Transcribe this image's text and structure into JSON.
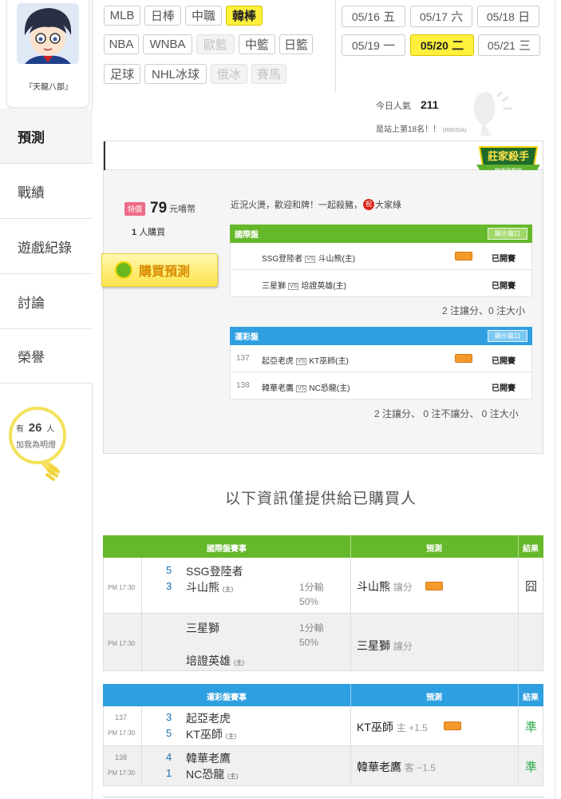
{
  "user": {
    "name": "『天龍八部』"
  },
  "sidebar": {
    "tabs": [
      {
        "label": "預測"
      },
      {
        "label": "戰績"
      },
      {
        "label": "遊戲紀錄"
      },
      {
        "label": "討論"
      },
      {
        "label": "榮譽"
      }
    ],
    "fans": {
      "prefix": "有",
      "count": "26",
      "suffix": "人",
      "text": "加我為明燈"
    }
  },
  "leagues": {
    "row1": [
      "MLB",
      "日棒",
      "中職",
      "韓棒"
    ],
    "row2": [
      "NBA",
      "WNBA",
      "歐籃",
      "中籃",
      "日籃"
    ],
    "row3": [
      "足球",
      "NHL冰球",
      "俄冰",
      "賽馬"
    ]
  },
  "dates": [
    {
      "date": "05/16",
      "day": "五"
    },
    {
      "date": "05/17",
      "day": "六"
    },
    {
      "date": "05/18",
      "day": "日"
    },
    {
      "date": "05/19",
      "day": "一"
    },
    {
      "date": "05/20",
      "day": "二"
    },
    {
      "date": "05/21",
      "day": "三"
    }
  ],
  "popularity": {
    "label": "今日人氣",
    "value": "211",
    "rank_text": "是站上第18名！！",
    "rank_code": "(R8033A)"
  },
  "badge": {
    "title": "莊家殺手",
    "sub": "韓棒國際盤"
  },
  "purchase": {
    "tag": "特價",
    "price": "79",
    "unit": "元嘻幣",
    "buyers_count": "1",
    "buyers_label": "人購買",
    "buy_label": "購買預測",
    "intro_pre": "近況火燙，歡迎和牌！一起殺豬，",
    "intro_mark": "祝",
    "intro_post": "大家綠"
  },
  "intl_table": {
    "title": "國際盤",
    "show_label": "顯示盤口",
    "rows": [
      {
        "num": "",
        "away": "SSG登陸者",
        "vs": "VS",
        "home": "斗山熊(主)",
        "status": "已開賽",
        "tag": true
      },
      {
        "num": "",
        "away": "三星獅",
        "vs": "VS",
        "home": "培證英雄(主)",
        "status": "已開賽",
        "tag": false
      }
    ],
    "summary": "2 注讓分、0 注大小"
  },
  "lottery_table": {
    "title": "運彩盤",
    "show_label": "顯示盤口",
    "rows": [
      {
        "num": "137",
        "away": "起亞老虎",
        "vs": "VS",
        "home": "KT巫師(主)",
        "status": "已開賽",
        "tag": true
      },
      {
        "num": "138",
        "away": "韓華老鷹",
        "vs": "VS",
        "home": "NC恐龍(主)",
        "status": "已開賽",
        "tag": false
      }
    ],
    "summary": "2 注讓分、 0 注不讓分、 0 注大小"
  },
  "locked_notice": "以下資訊僅提供給已購買人",
  "result_intl": {
    "headers": [
      "國際盤賽事",
      "預測",
      "結果"
    ],
    "rows": [
      {
        "time": "PM 17:30",
        "s1": "5",
        "t1": "SSG登陸者",
        "s2": "3",
        "t2": "斗山熊",
        "t2m": "(主)",
        "line": "1分輸",
        "pct": "50%",
        "pick": "斗山熊",
        "ptype": "讓分",
        "result": "囧"
      },
      {
        "time": "PM 17:30",
        "s1": "",
        "t1": "三星獅",
        "s2": "",
        "t2": "培證英雄",
        "t2m": "(主)",
        "line": "1分輸",
        "pct": "50%",
        "pick": "三星獅",
        "ptype": "讓分",
        "result": ""
      }
    ]
  },
  "result_lottery": {
    "headers": [
      "運彩盤賽事",
      "預測",
      "結果"
    ],
    "rows": [
      {
        "num": "137",
        "time": "PM 17:30",
        "s1": "3",
        "t1": "起亞老虎",
        "s2": "5",
        "t2": "KT巫師",
        "t2m": "(主)",
        "pick": "KT巫師",
        "ptype": "主 +1.5",
        "result": "準"
      },
      {
        "num": "138",
        "time": "PM 17:30",
        "s1": "4",
        "t1": "韓華老鷹",
        "s2": "1",
        "t2": "NC恐龍",
        "t2m": "(主)",
        "pick": "韓華老鷹",
        "ptype": "客 −1.5",
        "result": "準"
      }
    ]
  }
}
